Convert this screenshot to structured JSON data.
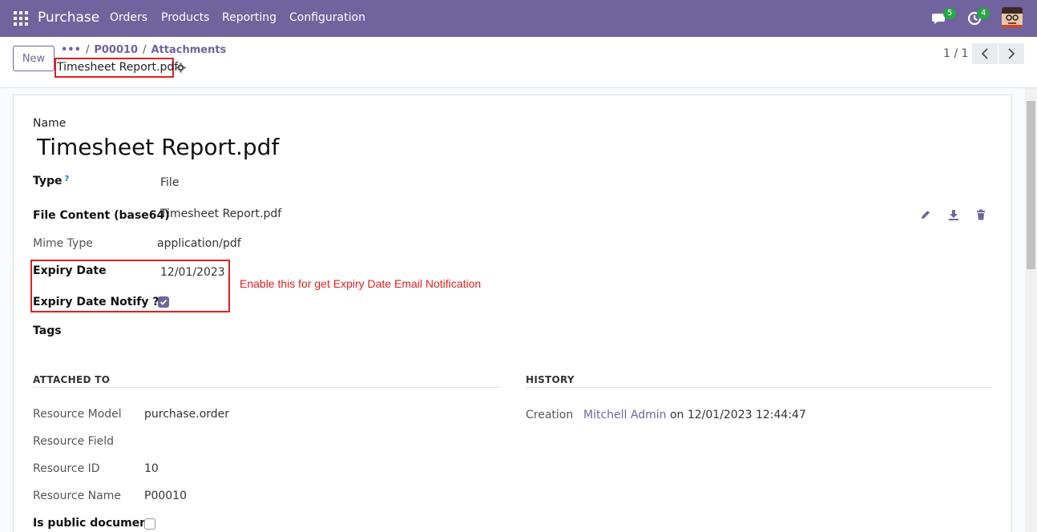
{
  "navbar": {
    "brand": "Purchase",
    "menu": [
      "Orders",
      "Products",
      "Reporting",
      "Configuration"
    ],
    "messages_badge": "5",
    "activities_badge": "4"
  },
  "control_panel": {
    "new_label": "New",
    "breadcrumb": [
      "P00010",
      "Attachments"
    ],
    "record_title": "Timesheet Report.pdf",
    "pager": "1 / 1"
  },
  "form": {
    "name_label": "Name",
    "name_value": "Timesheet Report.pdf",
    "type_label": "Type",
    "type_help": "?",
    "type_value": "File",
    "file_content_label": "File Content (base64)",
    "file_content_value": "Timesheet Report.pdf",
    "mime_label": "Mime Type",
    "mime_value": "application/pdf",
    "expiry_label": "Expiry Date",
    "expiry_value": "12/01/2023",
    "notify_label": "Expiry Date Notify ??",
    "notify_checked": true,
    "tags_label": "Tags",
    "annotation": "Enable this for get Expiry Date Email Notification"
  },
  "attached_to": {
    "heading": "ATTACHED TO",
    "resource_model_label": "Resource Model",
    "resource_model_value": "purchase.order",
    "resource_field_label": "Resource Field",
    "resource_id_label": "Resource ID",
    "resource_id_value": "10",
    "resource_name_label": "Resource Name",
    "resource_name_value": "P00010",
    "public_label": "Is public document",
    "public_checked": false
  },
  "history": {
    "heading": "HISTORY",
    "creation_label": "Creation",
    "creation_user": "Mitchell Admin",
    "creation_on": "on 12/01/2023 12:44:47"
  },
  "colors": {
    "primary": "#71639e",
    "annotation": "#e02020",
    "badge": "#28a745"
  }
}
